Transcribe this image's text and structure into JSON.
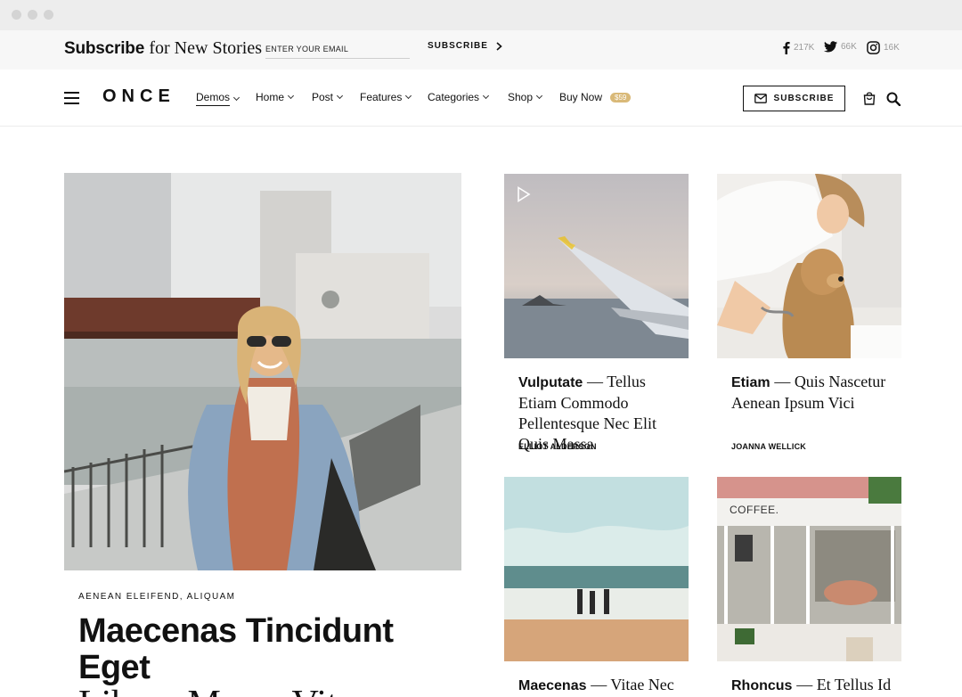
{
  "window": {
    "controls": [
      "close",
      "minimize",
      "maximize"
    ]
  },
  "topbar": {
    "title_bold": "Subscribe",
    "title_rest": "for New Stories",
    "email_placeholder": "ENTER YOUR EMAIL",
    "subscribe_label": "SUBSCRIBE",
    "social": [
      {
        "icon": "facebook-icon",
        "count": "217K"
      },
      {
        "icon": "twitter-icon",
        "count": "66K"
      },
      {
        "icon": "instagram-icon",
        "count": "16K"
      }
    ]
  },
  "nav": {
    "logo": "ONCE",
    "items": [
      {
        "label": "Demos",
        "active": true,
        "dropdown": true
      },
      {
        "label": "Home",
        "dropdown": true
      },
      {
        "label": "Post",
        "dropdown": true
      },
      {
        "label": "Features",
        "dropdown": true
      },
      {
        "label": "Categories",
        "dropdown": true
      },
      {
        "label": "Shop",
        "dropdown": true
      },
      {
        "label": "Buy Now",
        "badge": "$59"
      }
    ],
    "subscribe_label": "SUBSCRIBE",
    "icons": [
      "menu-icon",
      "mail-icon",
      "cart-icon",
      "search-icon"
    ]
  },
  "hero": {
    "category": "AENEAN ELEIFEND, ALIQUAM",
    "title_bold": "Maecenas Tincidunt Eget",
    "title_rest": "Libero Massa Vitae"
  },
  "cards": [
    {
      "title_bold": "Vulputate",
      "title_rest": "— Tellus Etiam Commodo Pellentesque Nec Elit Quis Massa",
      "author": "ELLIOT ALDERSON",
      "icon": "play-icon"
    },
    {
      "title_bold": "Etiam",
      "title_rest": "— Quis Nascetur Aenean Ipsum Vici",
      "author": "JOANNA WELLICK"
    },
    {
      "title_bold": "Maecenas",
      "title_rest": "— Vitae Nec"
    },
    {
      "title_bold": "Rhoncus",
      "title_rest": "— Et Tellus Id",
      "image_text": "COFFEE."
    }
  ],
  "colors": {
    "badge": "#d9b978",
    "topbar_bg": "#f7f7f7",
    "chrome_bg": "#ededed"
  }
}
